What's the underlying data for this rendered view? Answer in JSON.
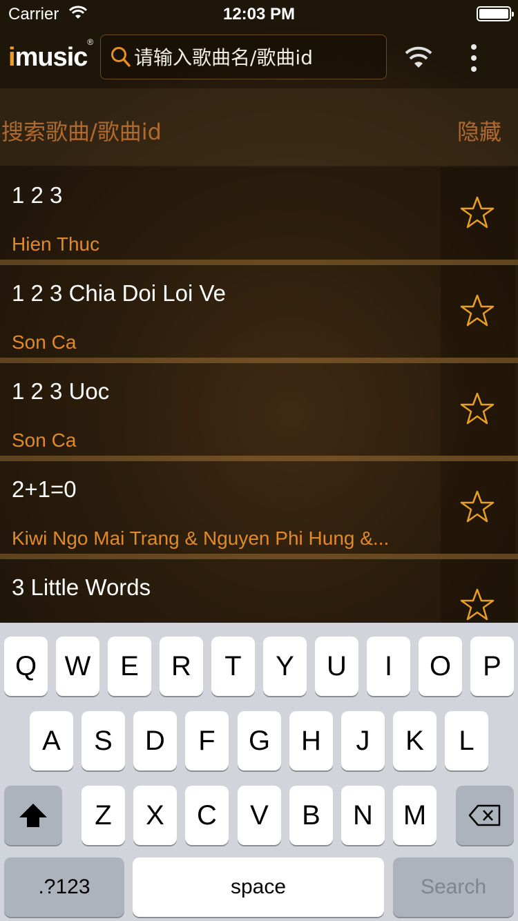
{
  "status_bar": {
    "carrier": "Carrier",
    "time": "12:03 PM"
  },
  "header": {
    "logo_i": "i",
    "logo_text": "music",
    "logo_reg": "®",
    "search_placeholder": "请输入歌曲名/歌曲id"
  },
  "subheader": {
    "title": "搜索歌曲/歌曲id",
    "hide_label": "隐藏"
  },
  "songs": [
    {
      "title": "1 2 3",
      "artist": "Hien Thuc"
    },
    {
      "title": "1 2 3 Chia Doi Loi Ve",
      "artist": "Son Ca"
    },
    {
      "title": "1 2 3 Uoc",
      "artist": "Son Ca"
    },
    {
      "title": "2+1=0",
      "artist": "Kiwi Ngo Mai Trang & Nguyen Phi Hung &..."
    },
    {
      "title": "3 Little Words",
      "artist": ""
    }
  ],
  "keyboard": {
    "row1": [
      "Q",
      "W",
      "E",
      "R",
      "T",
      "Y",
      "U",
      "I",
      "O",
      "P"
    ],
    "row2": [
      "A",
      "S",
      "D",
      "F",
      "G",
      "H",
      "J",
      "K",
      "L"
    ],
    "row3": [
      "Z",
      "X",
      "C",
      "V",
      "B",
      "N",
      "M"
    ],
    "numbers_label": ".?123",
    "space_label": "space",
    "search_label": "Search"
  },
  "colors": {
    "accent": "#e08a2a",
    "subheader_text": "#b06a30"
  }
}
